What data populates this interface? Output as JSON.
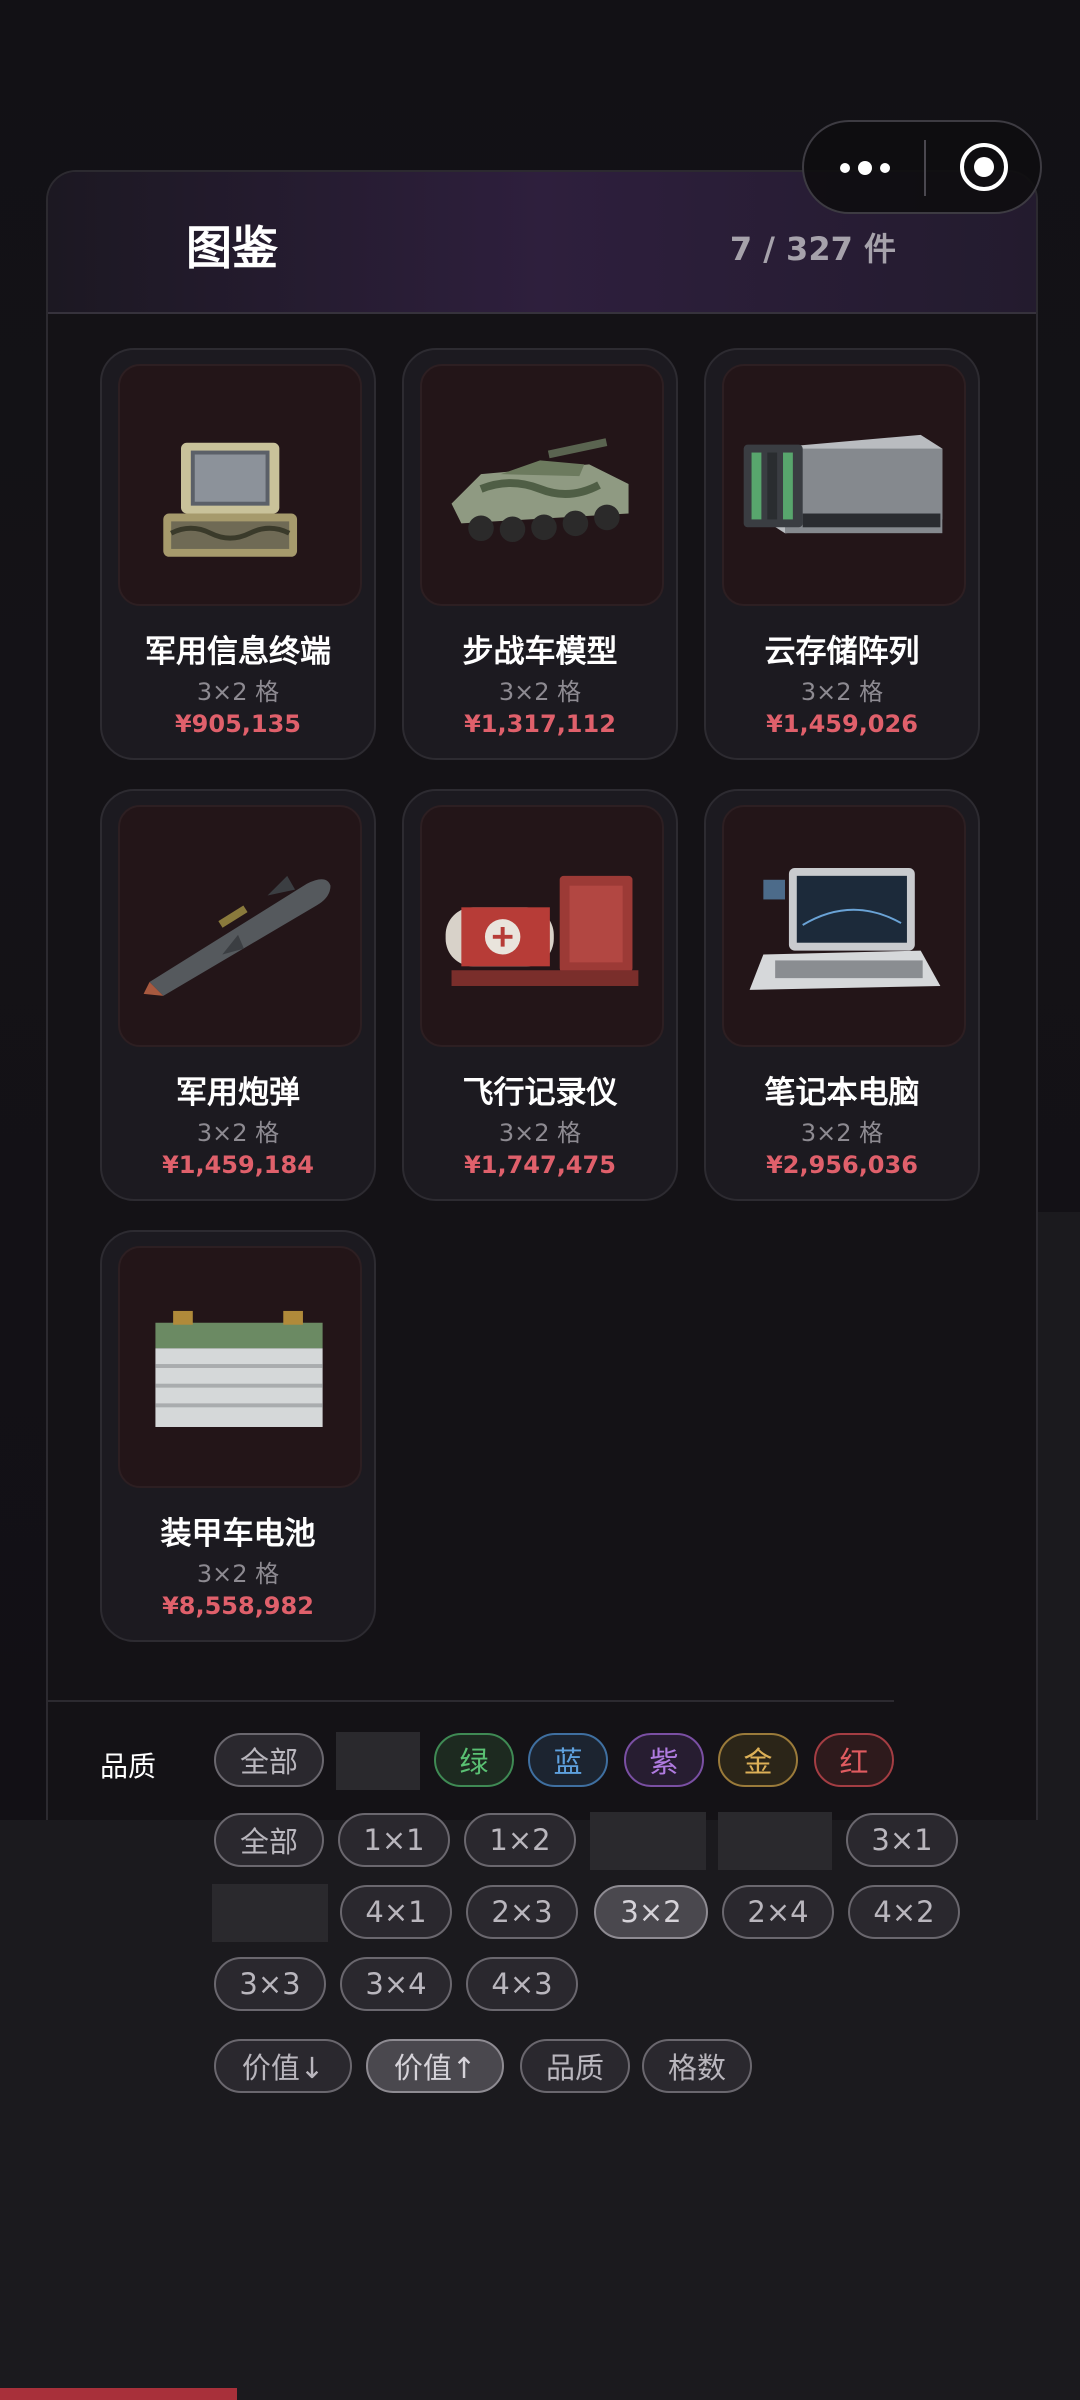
{
  "header": {
    "title": "图鉴",
    "count": "7 / 327 件"
  },
  "items": [
    {
      "name": "军用信息终端",
      "size": "3×2 格",
      "price": "¥905,135",
      "icon": "rugged-laptop-case-icon"
    },
    {
      "name": "步战车模型",
      "size": "3×2 格",
      "price": "¥1,317,112",
      "icon": "armored-vehicle-icon"
    },
    {
      "name": "云存储阵列",
      "size": "3×2 格",
      "price": "¥1,459,026",
      "icon": "server-array-icon"
    },
    {
      "name": "军用炮弹",
      "size": "3×2 格",
      "price": "¥1,459,184",
      "icon": "missile-icon"
    },
    {
      "name": "飞行记录仪",
      "size": "3×2 格",
      "price": "¥1,747,475",
      "icon": "flight-recorder-icon"
    },
    {
      "name": "笔记本电脑",
      "size": "3×2 格",
      "price": "¥2,956,036",
      "icon": "laptop-icon"
    },
    {
      "name": "装甲车电池",
      "size": "3×2 格",
      "price": "¥8,558,982",
      "icon": "battery-icon"
    }
  ],
  "filters": {
    "quality_label": "品质",
    "quality": [
      "全部",
      "绿",
      "蓝",
      "紫",
      "金",
      "红"
    ],
    "size_row1": [
      "全部",
      "1×1",
      "1×2",
      "3×1"
    ],
    "size_row2": [
      "4×1",
      "2×3",
      "3×2",
      "2×4",
      "4×2"
    ],
    "size_row3": [
      "3×3",
      "3×4",
      "4×3"
    ],
    "sort": [
      "价值↓",
      "价值↑",
      "品质",
      "格数"
    ],
    "selected_size": "3×2",
    "selected_sort": "价值↑"
  },
  "colors": {
    "price": "#e0606b",
    "green": "#5ac173",
    "blue": "#5ea0dd",
    "purple": "#b07be0",
    "gold": "#dcb057",
    "red": "#e05b60"
  }
}
